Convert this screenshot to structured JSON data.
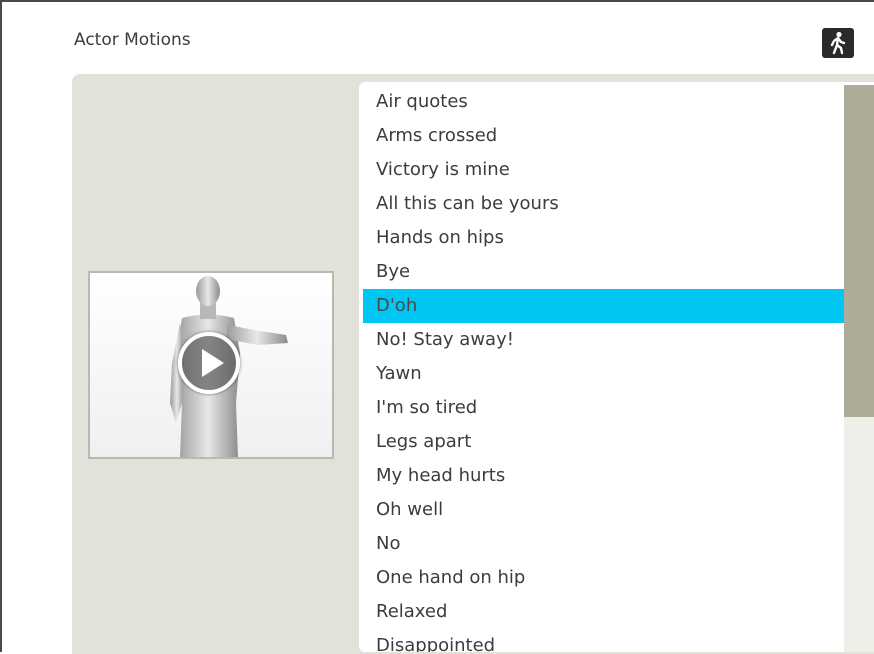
{
  "panel": {
    "title": "Actor Motions",
    "walk_button_icon": "walking-person-icon"
  },
  "preview": {
    "play_icon": "play-icon",
    "figure": "actor-figure"
  },
  "motions": {
    "items": [
      "Air quotes",
      "Arms crossed",
      "Victory is mine",
      "All this can be yours",
      "Hands on hips",
      "Bye",
      "D'oh",
      "No! Stay away!",
      "Yawn",
      "I'm so tired",
      "Legs apart",
      "My head hurts",
      "Oh well",
      "No",
      "One hand on hip",
      "Relaxed",
      "Disappointed"
    ],
    "selected": "D'oh"
  },
  "colors": {
    "selection": "#00c6f4",
    "panel_bg": "#e2e1da",
    "scroll_thumb": "#aeab98"
  },
  "scroll": {
    "thumb_fraction": 0.58
  }
}
